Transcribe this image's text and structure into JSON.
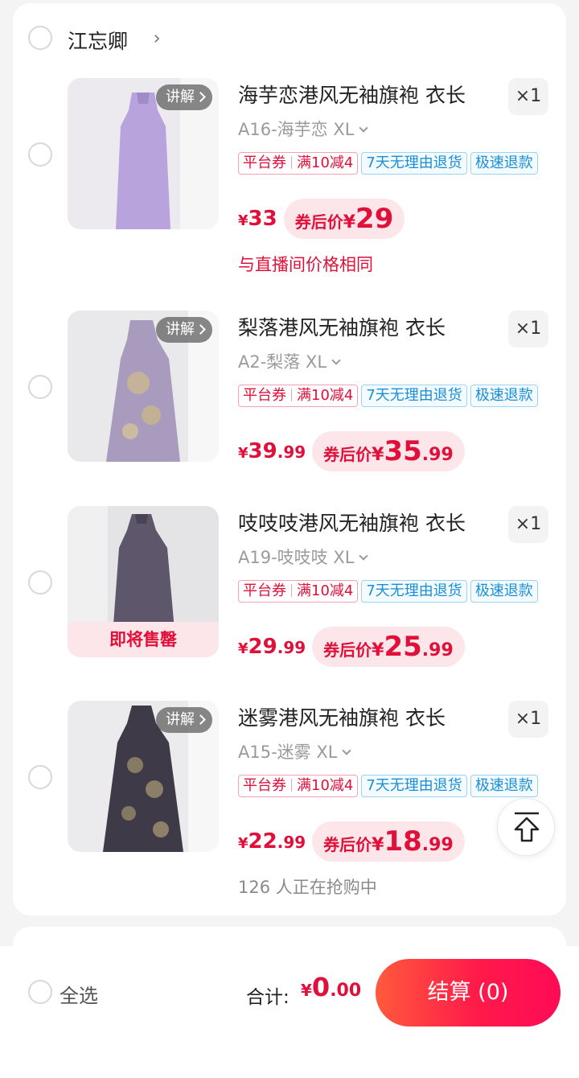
{
  "shop": {
    "name": "江忘卿"
  },
  "items": [
    {
      "title": "海芋恋港风无袖旗袍 衣长",
      "spec": "A16-海芋恋 XL",
      "qty": "×1",
      "explain": "讲解",
      "tags": {
        "platform": "平台券",
        "discount": "满10减4",
        "return": "7天无理由退货",
        "refund": "极速退款"
      },
      "price": {
        "yen": "¥",
        "int": "33",
        "dec": ""
      },
      "coupon": {
        "label": "券后价",
        "yen": "¥",
        "int": "29",
        "dec": ""
      },
      "note": "与直播间价格相同",
      "dress_color": "#b8a3dd"
    },
    {
      "title": "梨落港风无袖旗袍 衣长",
      "spec": "A2-梨落 XL",
      "qty": "×1",
      "explain": "讲解",
      "tags": {
        "platform": "平台券",
        "discount": "满10减4",
        "return": "7天无理由退货",
        "refund": "极速退款"
      },
      "price": {
        "yen": "¥",
        "int": "39",
        "dec": ".99"
      },
      "coupon": {
        "label": "券后价",
        "yen": "¥",
        "int": "35",
        "dec": ".99"
      },
      "note": "",
      "dress_color": "#a99bbd"
    },
    {
      "title": "吱吱吱港风无袖旗袍 衣长",
      "spec": "A19-吱吱吱 XL",
      "qty": "×1",
      "soldout": "即将售罄",
      "tags": {
        "platform": "平台券",
        "discount": "满10减4",
        "return": "7天无理由退货",
        "refund": "极速退款"
      },
      "price": {
        "yen": "¥",
        "int": "29",
        "dec": ".99"
      },
      "coupon": {
        "label": "券后价",
        "yen": "¥",
        "int": "25",
        "dec": ".99"
      },
      "note": "",
      "dress_color": "#5e566b"
    },
    {
      "title": "迷雾港风无袖旗袍 衣长",
      "spec": "A15-迷雾 XL",
      "qty": "×1",
      "explain": "讲解",
      "tags": {
        "platform": "平台券",
        "discount": "满10减4",
        "return": "7天无理由退货",
        "refund": "极速退款"
      },
      "price": {
        "yen": "¥",
        "int": "22",
        "dec": ".99"
      },
      "coupon": {
        "label": "券后价",
        "yen": "¥",
        "int": "18",
        "dec": ".99"
      },
      "note": "126 人正在抢购中",
      "dress_color": "#3f3a48"
    }
  ],
  "footer": {
    "select_all": "全选",
    "total_label": "合计:",
    "total": {
      "yen": "¥",
      "int": "0",
      "dec": ".00"
    },
    "checkout": "结算 (0)"
  },
  "colors": {
    "accent": "#e0103a",
    "tag_blue": "#1a8fd6",
    "checkout_start": "#ff5a3c",
    "checkout_end": "#fe0b56"
  },
  "icons": {
    "shop_chevron": "chevron-right-icon",
    "back_to_top": "arrow-up-icon"
  }
}
